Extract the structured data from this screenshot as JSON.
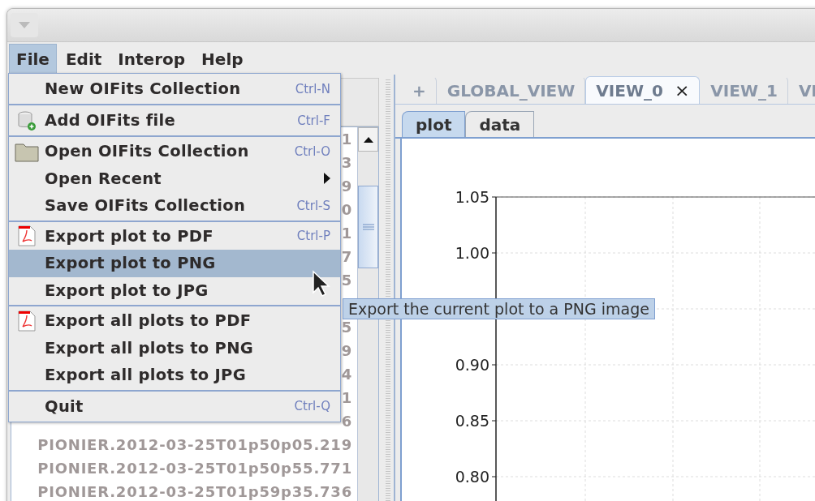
{
  "menubar": [
    {
      "label": "File",
      "selected": true
    },
    {
      "label": "Edit",
      "selected": false
    },
    {
      "label": "Interop",
      "selected": false
    },
    {
      "label": "Help",
      "selected": false
    }
  ],
  "file_menu": [
    {
      "items": [
        {
          "label": "New OIFits Collection",
          "shortcut": "Ctrl-N",
          "submenu": false,
          "selected": false
        }
      ]
    },
    {
      "items": [
        {
          "label": "Add OIFits file",
          "shortcut": "Ctrl-F",
          "kind": "database",
          "submenu": false,
          "selected": false
        }
      ]
    },
    {
      "items": [
        {
          "label": "Open OIFits Collection",
          "shortcut": "Ctrl-O",
          "kind": "folder",
          "submenu": false,
          "selected": false
        },
        {
          "label": "Open Recent",
          "submenu": true,
          "selected": false
        },
        {
          "label": "Save OIFits Collection",
          "shortcut": "Ctrl-S",
          "submenu": false,
          "selected": false
        }
      ]
    },
    {
      "items": [
        {
          "label": "Export plot to PDF",
          "shortcut": "Ctrl-P",
          "kind": "pdf",
          "submenu": false,
          "selected": false
        },
        {
          "label": "Export plot to PNG",
          "submenu": false,
          "selected": true
        },
        {
          "label": "Export plot to JPG",
          "submenu": false,
          "selected": false
        }
      ]
    },
    {
      "items": [
        {
          "label": "Export all plots to PDF",
          "kind": "pdf",
          "submenu": false,
          "selected": false
        },
        {
          "label": "Export all plots to PNG",
          "submenu": false,
          "selected": false
        },
        {
          "label": "Export all plots to JPG",
          "submenu": false,
          "selected": false
        }
      ]
    },
    {
      "items": [
        {
          "label": "Quit",
          "shortcut": "Ctrl-Q",
          "submenu": false,
          "selected": false
        }
      ]
    }
  ],
  "tooltip": "Export the current plot to a PNG image",
  "file_list": {
    "rows": [
      {
        "text": "1"
      },
      {
        "text": "3"
      },
      {
        "text": "9"
      },
      {
        "text": "0"
      },
      {
        "text": "1"
      },
      {
        "text": "7"
      },
      {
        "text": "5"
      },
      {
        "text": ""
      },
      {
        "text": "5"
      },
      {
        "text": "9"
      },
      {
        "text": "4"
      },
      {
        "text": "1"
      },
      {
        "text": "6"
      },
      {
        "text": "PIONIER.2012-03-25T01p50p05.219"
      },
      {
        "text": "PIONIER.2012-03-25T01p50p55.771"
      },
      {
        "text": "PIONIER.2012-03-25T01p59p35.736"
      }
    ]
  },
  "view_tabs": [
    {
      "label": "+",
      "selected": false,
      "closable": false
    },
    {
      "label": "GLOBAL_VIEW",
      "selected": false,
      "closable": false
    },
    {
      "label": "VIEW_0",
      "selected": true,
      "closable": true,
      "close": "×"
    },
    {
      "label": "VIEW_1",
      "selected": false,
      "closable": false
    },
    {
      "label": "VI",
      "selected": false,
      "closable": false
    }
  ],
  "sub_tabs": [
    {
      "label": "plot",
      "selected": true
    },
    {
      "label": "data",
      "selected": false
    }
  ],
  "plot": {
    "y_tick_labels": [
      "1.05",
      "1.00",
      "0.90",
      "0.85",
      "0.80"
    ]
  }
}
